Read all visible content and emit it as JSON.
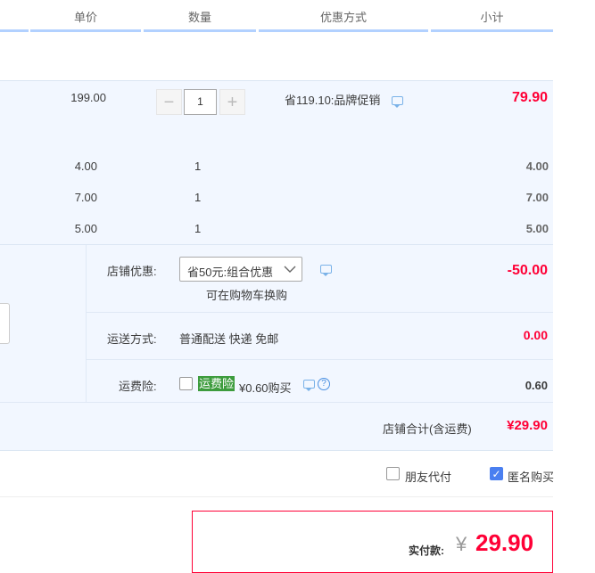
{
  "header": {
    "unit_price": "单价",
    "quantity": "数量",
    "discount_method": "优惠方式",
    "subtotal": "小计"
  },
  "main_item": {
    "unit_price": "199.00",
    "quantity": "1",
    "promo_text": "省119.10:品牌促销",
    "subtotal": "79.90",
    "stepper_minus": "−",
    "stepper_plus": "+"
  },
  "sub_items": [
    {
      "unit_price": "4.00",
      "quantity": "1",
      "subtotal": "4.00"
    },
    {
      "unit_price": "7.00",
      "quantity": "1",
      "subtotal": "7.00"
    },
    {
      "unit_price": "5.00",
      "quantity": "1",
      "subtotal": "5.00"
    }
  ],
  "shop": {
    "discount_label": "店铺优惠:",
    "discount_select": "省50元:组合优惠",
    "discount_note": "可在购物车换购",
    "discount_amount": "-50.00",
    "shipping_label": "运送方式:",
    "shipping_value": "普通配送 快递 免邮",
    "shipping_amount": "0.00",
    "insurance_label": "运费险:",
    "insurance_badge": "运费险",
    "insurance_text": "¥0.60购买",
    "insurance_amount": "0.60",
    "total_label": "店铺合计(含运费)",
    "total_amount": "¥29.90"
  },
  "options": {
    "friend_pay": "朋友代付",
    "anonymous": "匿名购买"
  },
  "summary": {
    "label": "实付款:",
    "currency": "¥",
    "amount": "29.90"
  },
  "colors": {
    "price_red": "#ff0036",
    "header_line": "#b2d1ff",
    "panel_bg": "#f2f7ff",
    "insurance_green": "#3d9c3d",
    "checkbox_blue": "#4a7ff0"
  }
}
